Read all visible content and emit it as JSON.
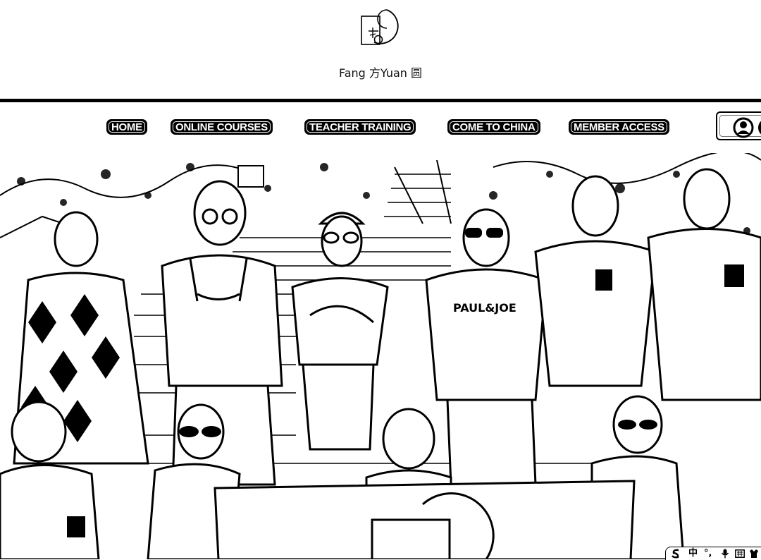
{
  "header": {
    "brand_text": "Fang 方Yuan 圆",
    "logo_icon": "fang-yuan-logo-icon"
  },
  "nav": {
    "items": [
      {
        "label": "HOME"
      },
      {
        "label": "ONLINE COURSES"
      },
      {
        "label": "TEACHER TRAINING"
      },
      {
        "label": "COME TO CHINA"
      },
      {
        "label": "MEMBER ACCESS"
      }
    ],
    "account_icon": "user-account-icon"
  },
  "hero": {
    "shirt_text": "PAUL&JOE"
  },
  "ime_toolbar": {
    "lang_label": "中",
    "punct_label": "°,",
    "icons": [
      "sogou-icon",
      "mic-icon",
      "keyboard-icon",
      "skin-icon"
    ]
  },
  "colors": {
    "ink": "#000000",
    "paper": "#ffffff"
  }
}
